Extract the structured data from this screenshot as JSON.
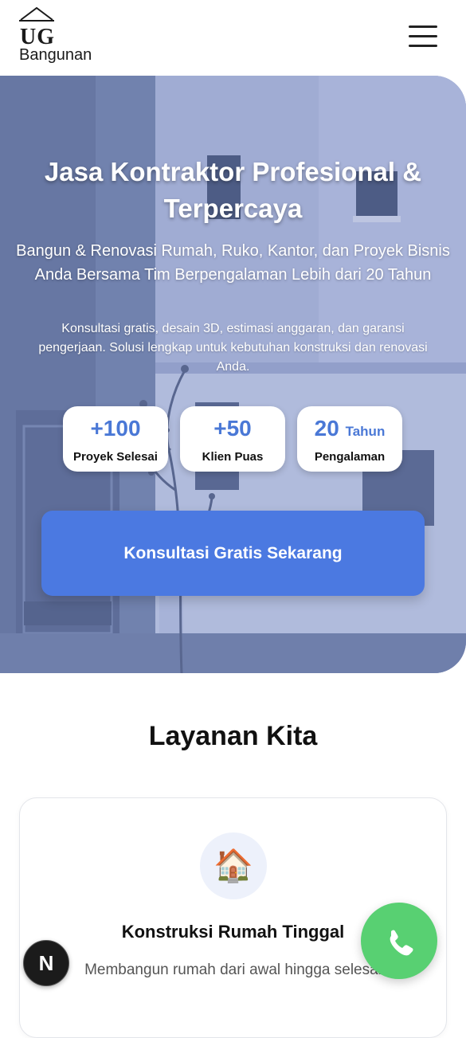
{
  "brand": {
    "logo_abbr": "UG",
    "name": "Bangunan"
  },
  "hero": {
    "title": "Jasa Kontraktor Profesional & Terpercaya",
    "subtitle": "Bangun & Renovasi Rumah, Ruko, Kantor, dan Proyek Bisnis Anda Bersama Tim Berpengalaman Lebih dari 20 Tahun",
    "description": "Konsultasi gratis, desain 3D, estimasi anggaran, dan garansi pengerjaan. Solusi lengkap untuk kebutuhan konstruksi dan renovasi Anda.",
    "stats": [
      {
        "value": "+100",
        "unit": "",
        "label": "Proyek Selesai"
      },
      {
        "value": "+50",
        "unit": "",
        "label": "Klien Puas"
      },
      {
        "value": "20",
        "unit": "Tahun",
        "label": "Pengalaman"
      }
    ],
    "cta_label": "Konsultasi Gratis Sekarang"
  },
  "services": {
    "title": "Layanan Kita",
    "items": [
      {
        "icon": "house-icon",
        "icon_glyph": "🏠",
        "title": "Konstruksi Rumah Tinggal",
        "description": "Membangun rumah dari awal hingga selesai"
      }
    ]
  },
  "floating": {
    "phone_icon": "phone-icon",
    "dev_badge_letter": "N"
  },
  "colors": {
    "accent": "#4b79e1",
    "stat_number": "#4a78d6",
    "whatsapp_green": "#58d072"
  }
}
